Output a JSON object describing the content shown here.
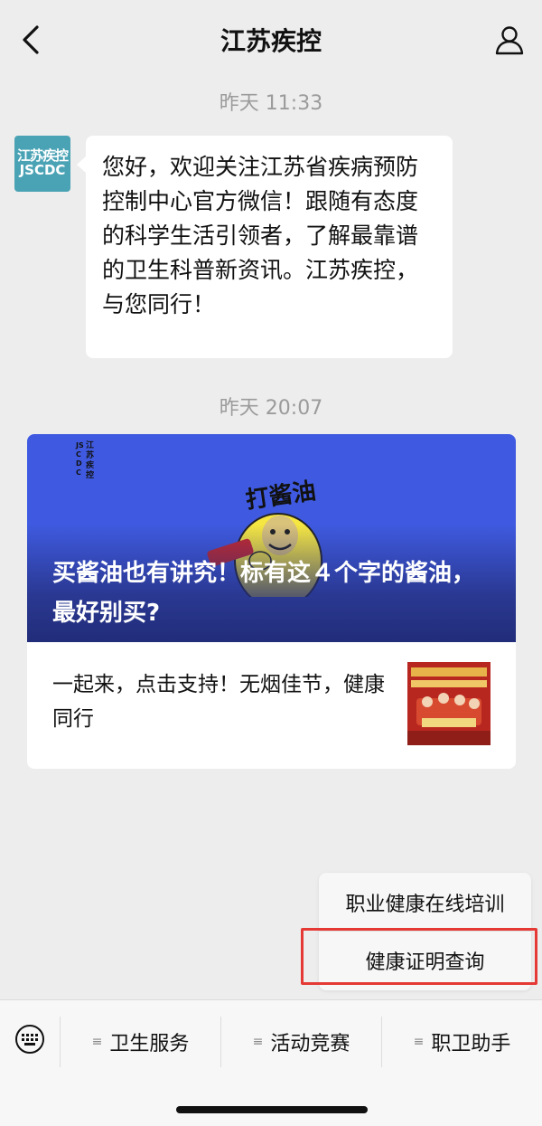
{
  "header": {
    "title": "江苏疾控"
  },
  "messages": {
    "t1": "昨天 11:33",
    "welcome": "您好，欢迎关注江苏省疾病预防控制中心官方微信！跟随有态度的科学生活引领者，了解最靠谱的卫生科普新资讯。江苏疾控，与您同行！",
    "avatar_line1": "江苏疾控",
    "avatar_line2": "JSCDC",
    "t2": "昨天 20:07"
  },
  "article": {
    "cover_logo_left": "JSCDC",
    "cover_logo_right": "江苏疾控",
    "cover_sticker_text": "打酱油",
    "cover_title": "买酱油也有讲究！标有这４个字的酱油，最好别买?",
    "sub_title": "一起来，点击支持！无烟佳节，健康同行"
  },
  "popup": {
    "items": [
      "职业健康在线培训",
      "健康证明查询"
    ]
  },
  "menu": {
    "items": [
      "卫生服务",
      "活动竞赛",
      "职卫助手"
    ]
  },
  "colors": {
    "cover_bg": "#3f5ae0",
    "highlight": "#e53935",
    "avatar_bg": "#4aa3b5"
  }
}
